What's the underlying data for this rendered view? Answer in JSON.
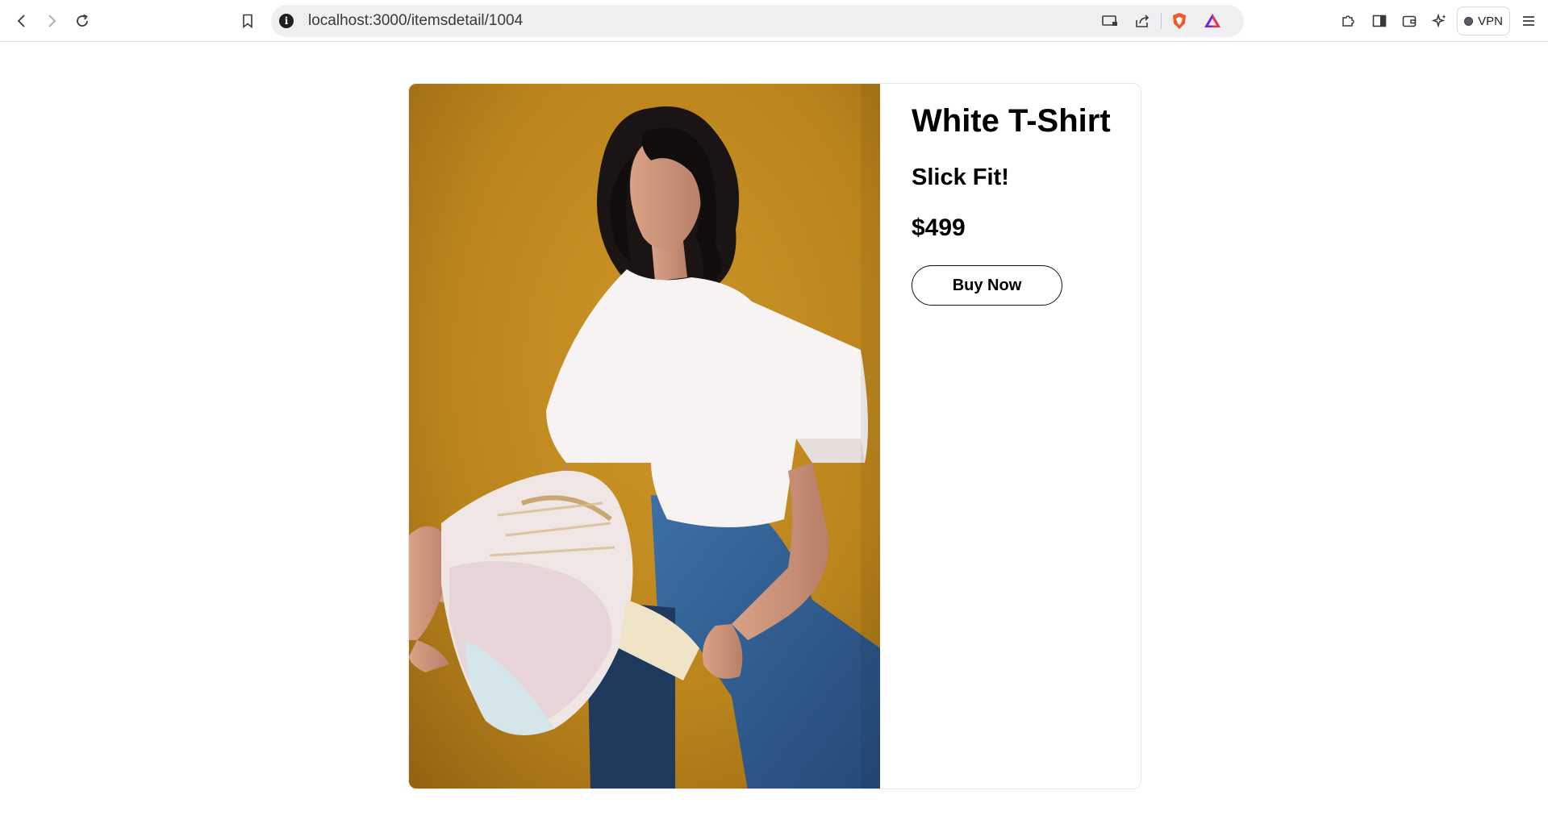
{
  "browser": {
    "url": "localhost:3000/itemsdetail/1004",
    "vpn_label": "VPN",
    "icons": [
      "back-icon",
      "forward-icon",
      "reload-icon",
      "bookmark-icon",
      "info-icon",
      "cast-icon",
      "share-icon",
      "brave-shield-icon",
      "brave-rewards-icon",
      "extensions-icon",
      "sidebar-icon",
      "wallet-icon",
      "leo-ai-icon",
      "menu-icon"
    ]
  },
  "product": {
    "name": "White T-Shirt",
    "tagline": "Slick Fit!",
    "price": "$499",
    "buy_label": "Buy Now",
    "image_alt": "Woman in white t-shirt and blue jeans holding a basket against a mustard background"
  },
  "colors": {
    "image_background": "#c28a1e",
    "card_border": "#e7e7e7",
    "button_border": "#111111"
  }
}
